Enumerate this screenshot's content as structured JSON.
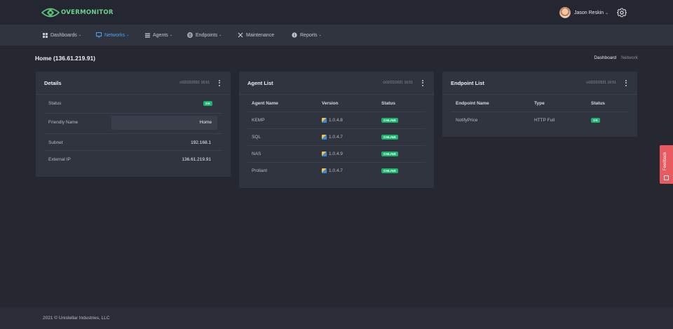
{
  "app": {
    "logo_text": "OVERMONITOR"
  },
  "user": {
    "name": "Jason Reskin"
  },
  "nav": {
    "items": [
      {
        "label": "Dashboards",
        "icon": "dashboard-icon"
      },
      {
        "label": "Networks",
        "icon": "monitor-icon"
      },
      {
        "label": "Agents",
        "icon": "list-icon"
      },
      {
        "label": "Endpoints",
        "icon": "globe-icon"
      },
      {
        "label": "Maintenance",
        "icon": "tools-icon"
      },
      {
        "label": "Reports",
        "icon": "info-icon"
      }
    ],
    "active": "Networks"
  },
  "page": {
    "title": "Home (136.61.219.91)",
    "tabs": [
      "Dashboard",
      "Network"
    ]
  },
  "details": {
    "title": "Details",
    "time": "02/22/2021 16:51",
    "status_label": "Status",
    "status_value": "OK",
    "friendly_label": "Friendly Name",
    "friendly_value": "Home",
    "subnet_label": "Subnet",
    "subnet_value": "192.168.1",
    "ip_label": "External IP",
    "ip_value": "136.61.219.91"
  },
  "agents": {
    "title": "Agent List",
    "time": "02/22/2021 16:51",
    "columns": [
      "Agent Name",
      "Version",
      "Status"
    ],
    "rows": [
      {
        "name": "KEMP",
        "version": "1.0.4.8",
        "status": "ONLINE"
      },
      {
        "name": "SQL",
        "version": "1.0.4.7",
        "status": "ONLINE"
      },
      {
        "name": "NAS",
        "version": "1.0.4.9",
        "status": "ONLINE"
      },
      {
        "name": "Proliant",
        "version": "1.0.4.7",
        "status": "ONLINE"
      }
    ]
  },
  "endpoints": {
    "title": "Endpoint List",
    "time": "02/22/2021 16:51",
    "columns": [
      "Endpoint Name",
      "Type",
      "Status"
    ],
    "rows": [
      {
        "name": "NotifyPrice",
        "type": "HTTP Full",
        "status": "OK"
      }
    ]
  },
  "feedback": {
    "label": "Feedback"
  },
  "footer": {
    "text": "2021 © Unistellar Industries, LLC"
  },
  "colors": {
    "accent": "#4ea2f0",
    "ok": "#19b36b",
    "feedback": "#e85a5f",
    "logo": "#6fd28a"
  }
}
